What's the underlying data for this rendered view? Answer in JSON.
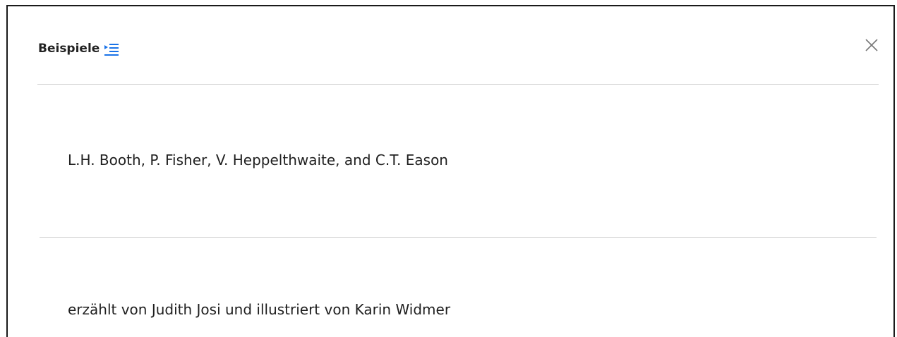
{
  "modal": {
    "title": "Beispiele",
    "title_icon": "list-indent-icon",
    "close_icon": "close-icon",
    "accent_color": "#1a73e8"
  },
  "entries": [
    {
      "text": "L.H. Booth, P. Fisher, V. Heppelthwaite, and C.T. Eason"
    },
    {
      "text": "erzählt von Judith Josi und illustriert von Karin Widmer"
    }
  ]
}
